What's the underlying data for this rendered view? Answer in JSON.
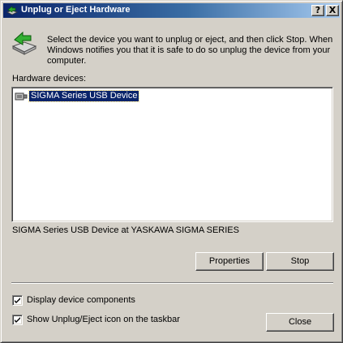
{
  "window": {
    "title": "Unplug or Eject Hardware",
    "help_button": "?",
    "close_button": "X"
  },
  "instructions": "Select the device you want to unplug or eject, and then click Stop. When Windows notifies you that it is safe to do so unplug the device from your computer.",
  "hardware_label": "Hardware devices:",
  "devices": [
    {
      "label": "SIGMA Series USB Device",
      "selected": true,
      "icon": "usb-device-icon"
    }
  ],
  "device_description": "SIGMA Series USB Device at YASKAWA SIGMA SERIES",
  "buttons": {
    "properties": "Properties",
    "stop": "Stop",
    "close": "Close"
  },
  "options": [
    {
      "label": "Display device components",
      "checked": true
    },
    {
      "label": "Show Unplug/Eject icon on the taskbar",
      "checked": true
    }
  ],
  "colors": {
    "face": "#d4d0c8",
    "title_start": "#0a246a",
    "title_end": "#a6caf0",
    "selection": "#0a246a"
  }
}
